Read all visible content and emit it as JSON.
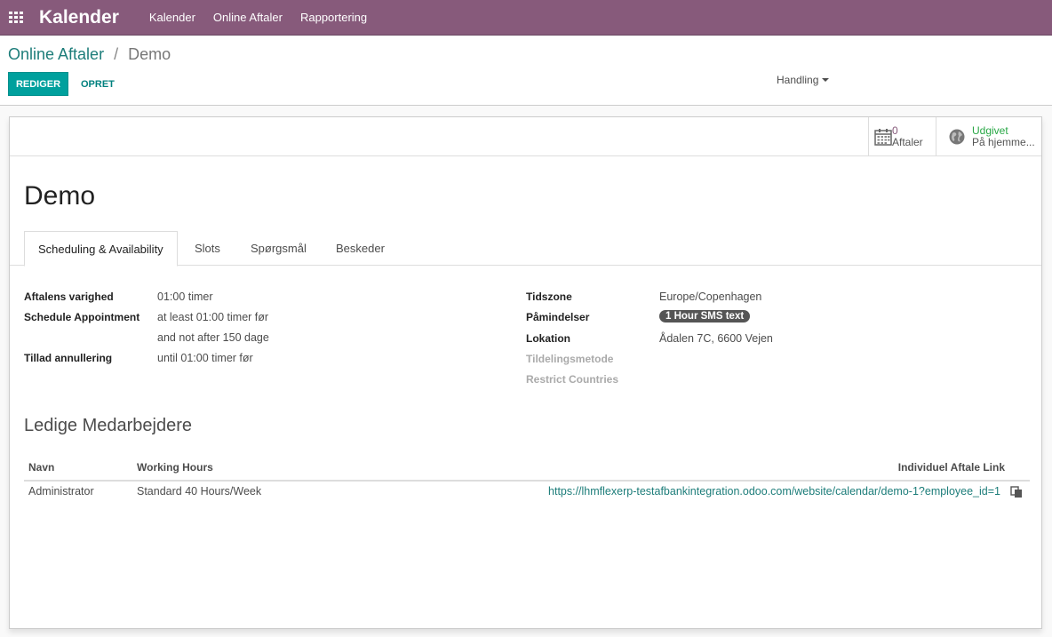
{
  "navbar": {
    "brand": "Kalender",
    "menu": [
      "Kalender",
      "Online Aftaler",
      "Rapportering"
    ]
  },
  "breadcrumb": {
    "parent": "Online Aftaler",
    "separator": "/",
    "current": "Demo"
  },
  "toolbar": {
    "edit_label": "REDIGER",
    "create_label": "OPRET",
    "action_label": "Handling"
  },
  "stat_buttons": {
    "aftaler_count": "0",
    "aftaler_label": "Aftaler",
    "published_status": "Udgivet",
    "published_label": "På hjemme..."
  },
  "record": {
    "title": "Demo"
  },
  "tabs": [
    "Scheduling & Availability",
    "Slots",
    "Spørgsmål",
    "Beskeder"
  ],
  "left_fields": {
    "duration_label": "Aftalens varighed",
    "duration_value": "01:00 timer",
    "schedule_label": "Schedule Appointment",
    "schedule_value_1": "at least 01:00 timer før",
    "schedule_value_2": "and not after 150 dage",
    "cancel_label": "Tillad annullering",
    "cancel_value": "until 01:00 timer før"
  },
  "right_fields": {
    "timezone_label": "Tidszone",
    "timezone_value": "Europe/Copenhagen",
    "reminders_label": "Påmindelser",
    "reminders_badge": "1 Hour SMS text",
    "location_label": "Lokation",
    "location_value": "Ådalen 7C, 6600 Vejen",
    "assignment_label": "Tildelingsmetode",
    "countries_label": "Restrict Countries"
  },
  "employees_section": {
    "title": "Ledige Medarbejdere",
    "columns": [
      "Navn",
      "Working Hours",
      "Individuel Aftale Link"
    ],
    "rows": [
      {
        "name": "Administrator",
        "hours": "Standard 40 Hours/Week",
        "link": "https://lhmflexerp-testafbankintegration.odoo.com/website/calendar/demo-1?employee_id=1"
      }
    ]
  },
  "colors": {
    "navbar": "#875a7b",
    "primary_button": "#00a09d",
    "link": "#1d7d7a",
    "published": "#28a745"
  }
}
